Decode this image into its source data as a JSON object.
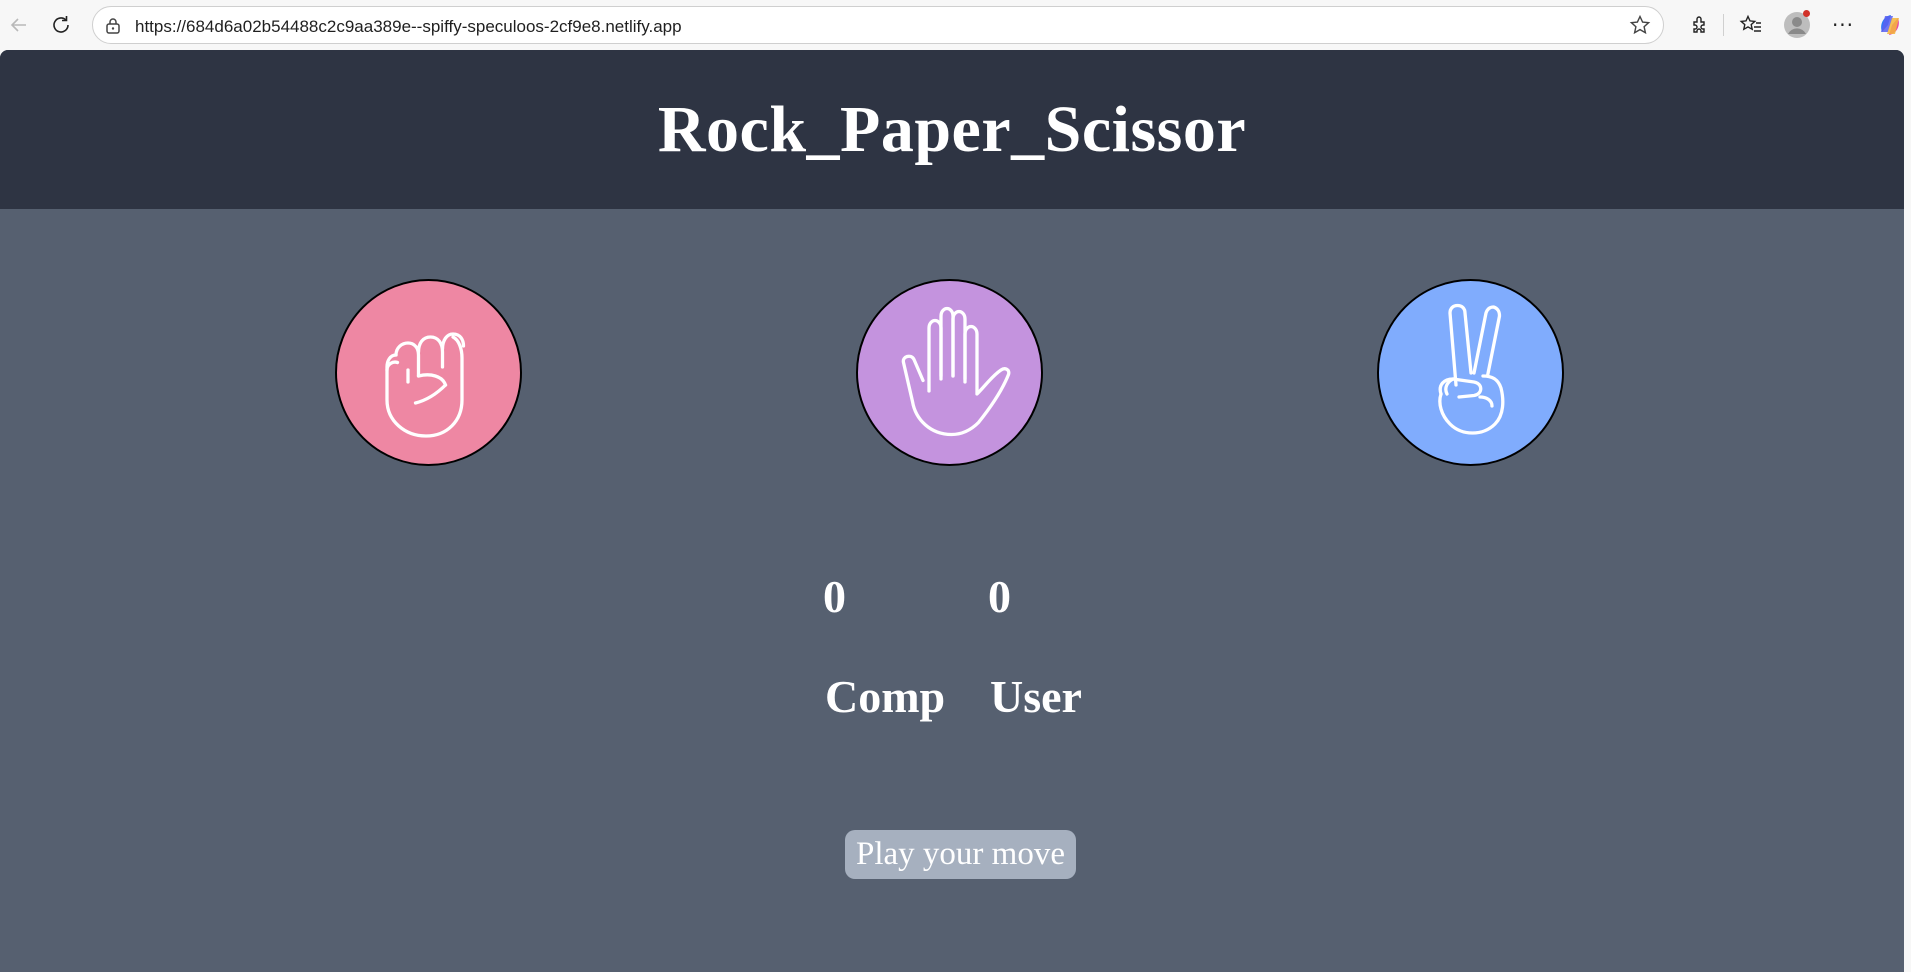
{
  "browser": {
    "url": "https://684d6a02b54488c2c9aa389e--spiffy-speculoos-2cf9e8.netlify.app",
    "icons": [
      "back-icon",
      "reload-icon",
      "lock-icon",
      "favorite-star-icon",
      "extensions-icon",
      "favorites-icon",
      "profile-icon",
      "more-icon",
      "copilot-icon"
    ]
  },
  "page": {
    "title": "Rock_Paper_Scissor",
    "choices": [
      {
        "id": "rock",
        "icon": "fist-icon",
        "color": "#ee87a3"
      },
      {
        "id": "paper",
        "icon": "open-hand-icon",
        "color": "#c493de"
      },
      {
        "id": "scissor",
        "icon": "victory-hand-icon",
        "color": "#80acfd"
      }
    ],
    "scoreboard": {
      "comp_score": "0",
      "user_score": "0",
      "comp_label": "Comp",
      "user_label": "User"
    },
    "message": "Play your move"
  },
  "colors": {
    "header_bg": "#2e3443",
    "body_bg": "#566070",
    "message_bg": "#a6b0bf"
  }
}
